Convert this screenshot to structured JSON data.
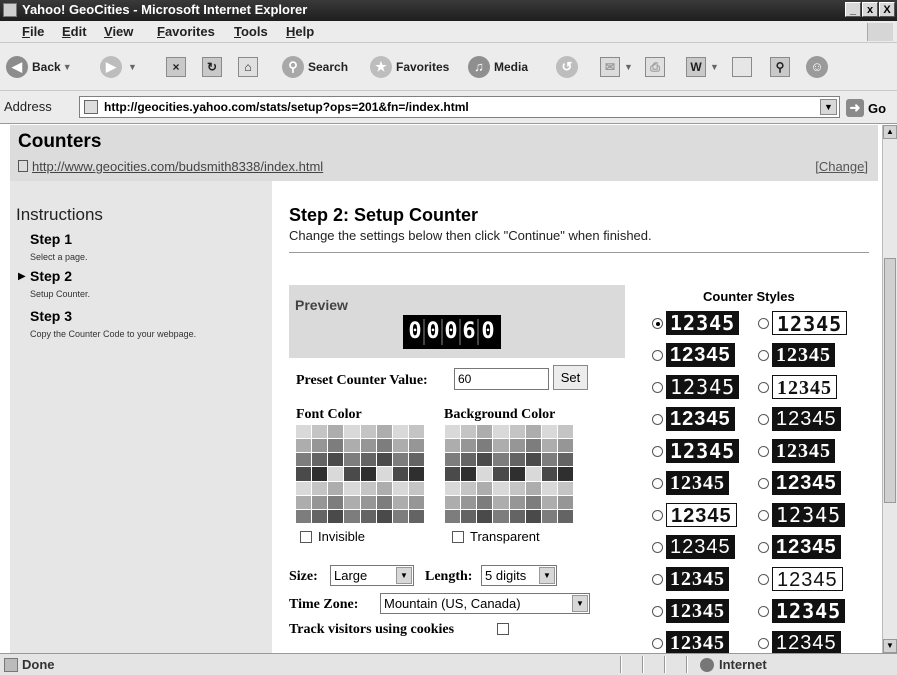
{
  "window": {
    "title": "Yahoo! GeoCities - Microsoft Internet Explorer",
    "controls": [
      "_",
      "х",
      "X"
    ]
  },
  "menu": [
    "File",
    "Edit",
    "View",
    "Favorites",
    "Tools",
    "Help"
  ],
  "toolbar": {
    "back": "Back",
    "search": "Search",
    "favorites": "Favorites",
    "media": "Media"
  },
  "address": {
    "label": "Address",
    "url": "http://geocities.yahoo.com/stats/setup?ops=201&fn=/index.html",
    "go": "Go"
  },
  "header": {
    "title": "Counters",
    "page_url": "http://www.geocities.com/budsmith8338/index.html",
    "change_open": "[",
    "change": "Change",
    "change_close": "]"
  },
  "instructions": {
    "heading": "Instructions",
    "steps": [
      {
        "title": "Step 1",
        "desc": "Select a page."
      },
      {
        "title": "Step 2",
        "desc": "Setup Counter."
      },
      {
        "title": "Step 3",
        "desc": "Copy the Counter Code to your webpage."
      }
    ],
    "current_marker": "▶"
  },
  "main": {
    "title": "Step 2: Setup Counter",
    "subtitle": "Change the settings below then click \"Continue\" when finished."
  },
  "preview": {
    "label": "Preview",
    "digits": [
      "0",
      "0",
      "0",
      "6",
      "0"
    ]
  },
  "preset": {
    "label": "Preset Counter Value:",
    "value": "60",
    "set": "Set"
  },
  "font_color": {
    "label": "Font Color",
    "invisible": "Invisible"
  },
  "bg_color": {
    "label": "Background Color",
    "transparent": "Transparent"
  },
  "size": {
    "label": "Size:",
    "value": "Large"
  },
  "length": {
    "label": "Length:",
    "value": "5 digits"
  },
  "timezone": {
    "label": "Time Zone:",
    "value": "Mountain (US, Canada)"
  },
  "cookies": {
    "label": "Track visitors using cookies"
  },
  "counter_styles": {
    "title": "Counter Styles",
    "items": [
      "12345",
      "12345",
      "12345",
      "12345",
      "12345",
      "12345",
      "12345",
      "12345",
      "12345",
      "12345",
      "12345",
      "12345",
      "12345",
      "12345",
      "12345",
      "12345",
      "12345",
      "12345",
      "12345",
      "12345",
      "12345",
      "12345"
    ]
  },
  "status": {
    "left": "Done",
    "zone": "Internet"
  },
  "colors": {
    "palette_grays": [
      "#d9d9d9",
      "#c4c4c4",
      "#adadad",
      "#969696",
      "#7d7d7d",
      "#646464",
      "#4a4a4a",
      "#2f2f2f"
    ]
  }
}
